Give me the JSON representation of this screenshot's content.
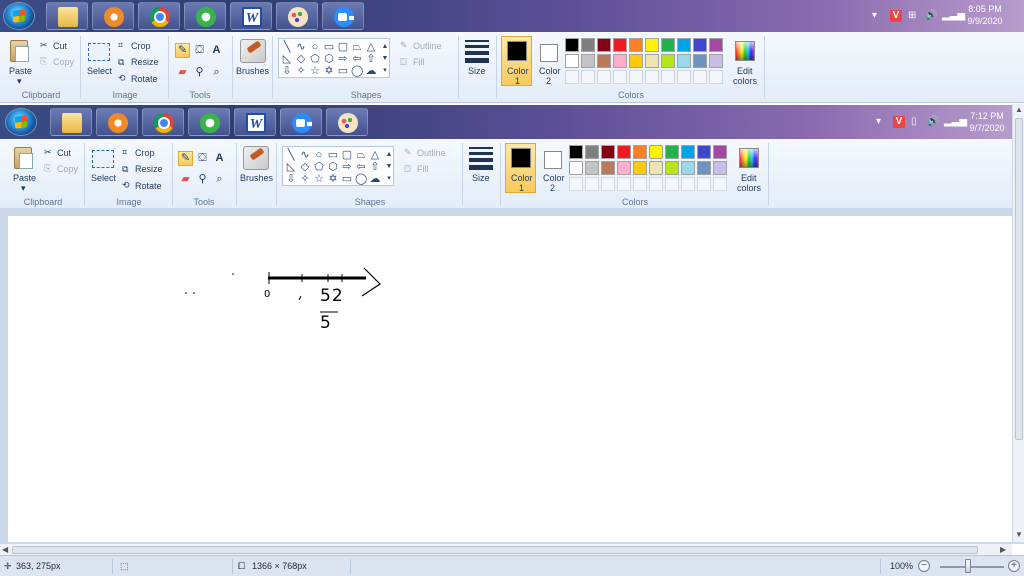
{
  "taskbar_top": {
    "clock_time": "8:05 PM",
    "clock_date": "9/9/2020"
  },
  "taskbar_inner": {
    "clock_time": "7:12 PM",
    "clock_date": "9/7/2020"
  },
  "tray": {
    "v_label": "V"
  },
  "ribbon": {
    "clipboard": {
      "paste": "Paste",
      "cut": "Cut",
      "copy": "Copy",
      "label": "Clipboard"
    },
    "image": {
      "select": "Select",
      "crop": "Crop",
      "resize": "Resize",
      "rotate": "Rotate",
      "label": "Image"
    },
    "tools": {
      "label": "Tools",
      "text_tool": "A"
    },
    "brushes": {
      "label": "Brushes"
    },
    "shapes": {
      "outline": "Outline",
      "fill": "Fill",
      "label": "Shapes"
    },
    "size": {
      "label": "Size"
    },
    "colors": {
      "color1_a": "Color",
      "color1_b": "1",
      "color2_a": "Color",
      "color2_b": "2",
      "edit_a": "Edit",
      "edit_b": "colors",
      "label": "Colors",
      "color1_value": "#000000",
      "color2_value": "#ffffff",
      "palette_row1": [
        "#000000",
        "#7f7f7f",
        "#880015",
        "#ed1c24",
        "#ff7f27",
        "#fff200",
        "#22b14c",
        "#00a2e8",
        "#3f48cc",
        "#a349a4"
      ],
      "palette_row2": [
        "#ffffff",
        "#c3c3c3",
        "#b97a57",
        "#ffaec9",
        "#ffc90e",
        "#efe4b0",
        "#b5e61d",
        "#99d9ea",
        "#7092be",
        "#c8bfe7"
      ]
    }
  },
  "drawing": {
    "label_zero": "0",
    "label_52": "52",
    "label_5": "5"
  },
  "statusbar": {
    "cursor_pos": "363, 275px",
    "image_size": "1366 × 768px",
    "zoom": "100%"
  }
}
